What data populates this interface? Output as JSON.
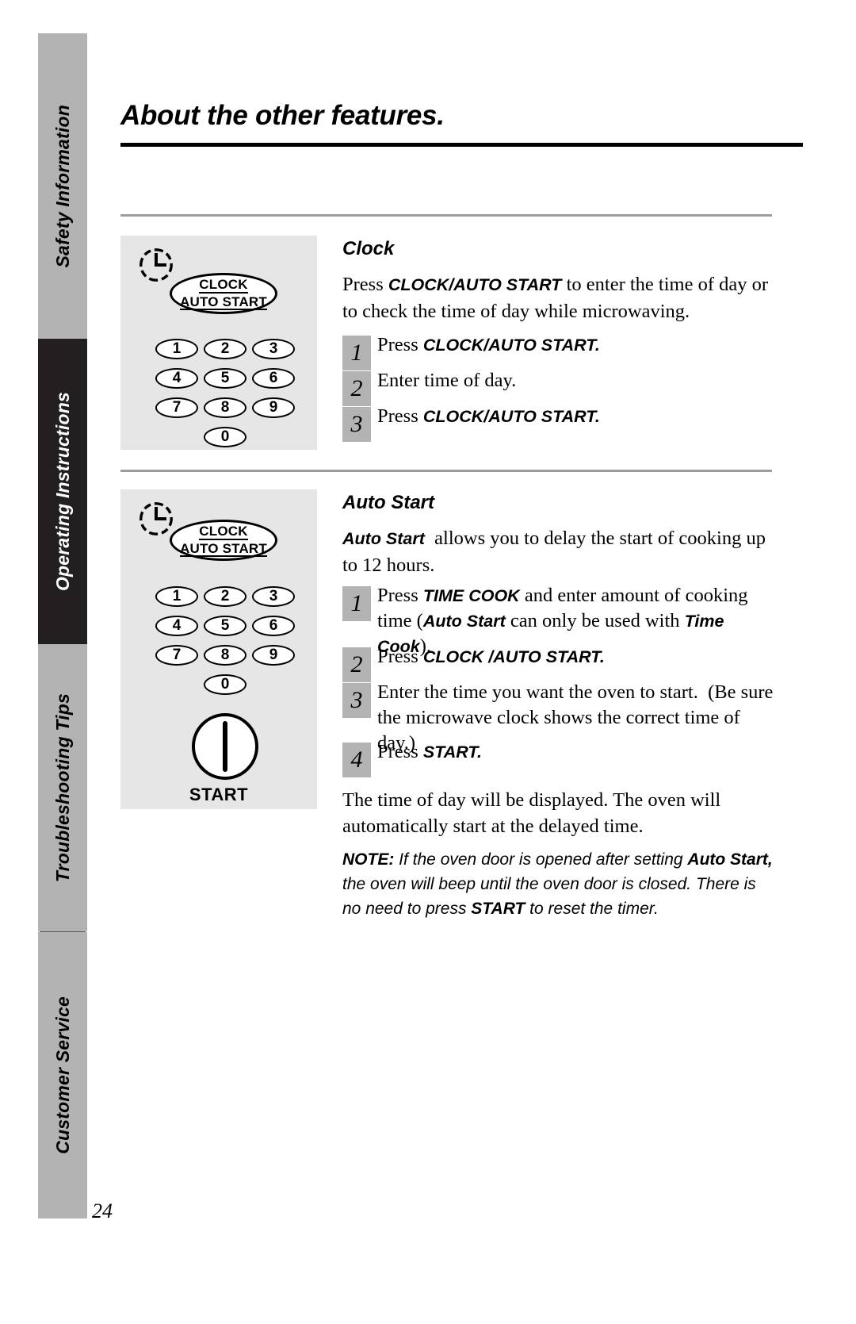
{
  "page": {
    "title": "About the other features.",
    "number": "24"
  },
  "sidebar": {
    "tabs": [
      {
        "label": "Safety Information",
        "style": "gray"
      },
      {
        "label": "Operating Instructions",
        "style": "black"
      },
      {
        "label": "Troubleshooting Tips",
        "style": "gray"
      },
      {
        "label": "Customer Service",
        "style": "gray"
      }
    ]
  },
  "panels": {
    "clock_panel": {
      "clock_icon": "clock-icon",
      "clock_button": {
        "line1": "CLOCK",
        "line2": "AUTO START"
      },
      "keypad": [
        "1",
        "2",
        "3",
        "4",
        "5",
        "6",
        "7",
        "8",
        "9",
        "0"
      ]
    },
    "auto_start_panel": {
      "clock_icon": "clock-icon",
      "clock_button": {
        "line1": "CLOCK",
        "line2": "AUTO START"
      },
      "keypad": [
        "1",
        "2",
        "3",
        "4",
        "5",
        "6",
        "7",
        "8",
        "9",
        "0"
      ],
      "start_button_label": "START"
    }
  },
  "sections": [
    {
      "heading": "Clock",
      "intro_html": "Press <b>CLOCK/AUTO START</b> to enter the time of day or to check the time of day while microwaving.",
      "steps": [
        {
          "num": "1",
          "html": "Press <b>CLOCK/AUTO START.</b>"
        },
        {
          "num": "2",
          "html": "Enter time of day."
        },
        {
          "num": "3",
          "html": "Press <b>CLOCK/AUTO START.</b>"
        }
      ]
    },
    {
      "heading": "Auto Start",
      "intro_html": "<b>Auto Start</b>&nbsp; allows you to delay the start of cooking up to 12 hours.",
      "steps": [
        {
          "num": "1",
          "html": "Press <b>TIME COOK</b> and enter amount of cooking time (<b>Auto Start</b> can only be used with <b>Time Cook</b>)."
        },
        {
          "num": "2",
          "html": "Press <b>CLOCK /AUTO START.</b>"
        },
        {
          "num": "3",
          "html": "Enter the time you want the oven to start.&nbsp; (Be sure the microwave clock shows the correct time of day.)"
        },
        {
          "num": "4",
          "html": "Press <b>START.</b>"
        }
      ],
      "outro_html": "The time of day will be displayed. The oven will automatically start at the delayed time.",
      "note_html": "<b>NOTE:</b> If the oven door is opened after setting <b>Auto Start,</b> the oven will beep until the oven door is closed. There is no need to press <b>START</b> to reset the timer."
    }
  ]
}
